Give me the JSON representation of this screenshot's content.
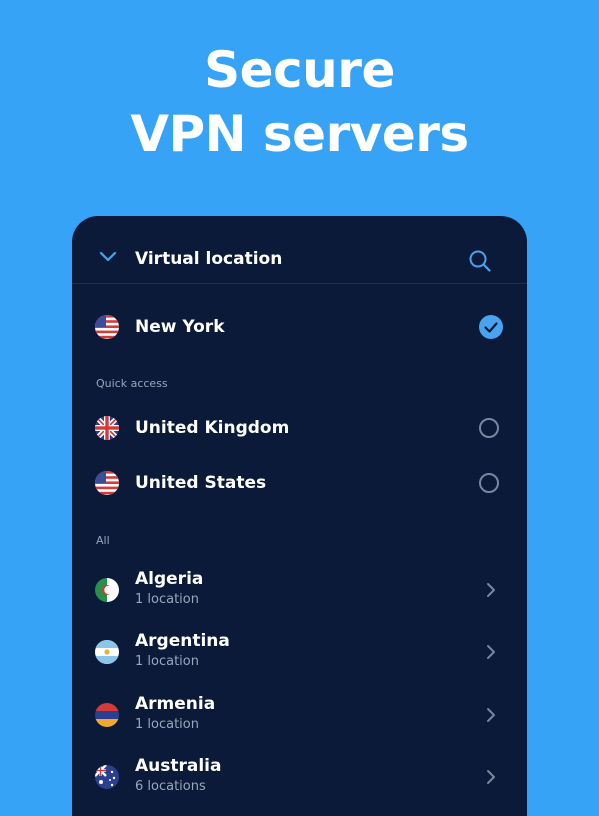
{
  "headline": {
    "line1": "Secure",
    "line2": "VPN servers"
  },
  "colors": {
    "background": "#36a3f7",
    "panel": "#0a1a38",
    "accent": "#4aa3f0"
  },
  "header": {
    "title": "Virtual location",
    "collapse_icon": "chevron-down-icon",
    "search_icon": "search-icon"
  },
  "selected": {
    "name": "New York",
    "flag": "us-flag",
    "status_icon": "checkmark-icon"
  },
  "quick_access": {
    "label": "Quick access",
    "items": [
      {
        "name": "United Kingdom",
        "flag": "uk-flag"
      },
      {
        "name": "United States",
        "flag": "us-flag"
      }
    ]
  },
  "all": {
    "label": "All",
    "items": [
      {
        "name": "Algeria",
        "sub": "1 location",
        "flag": "algeria-flag"
      },
      {
        "name": "Argentina",
        "sub": "1 location",
        "flag": "argentina-flag"
      },
      {
        "name": "Armenia",
        "sub": "1 location",
        "flag": "armenia-flag"
      },
      {
        "name": "Australia",
        "sub": "6 locations",
        "flag": "australia-flag"
      }
    ]
  }
}
